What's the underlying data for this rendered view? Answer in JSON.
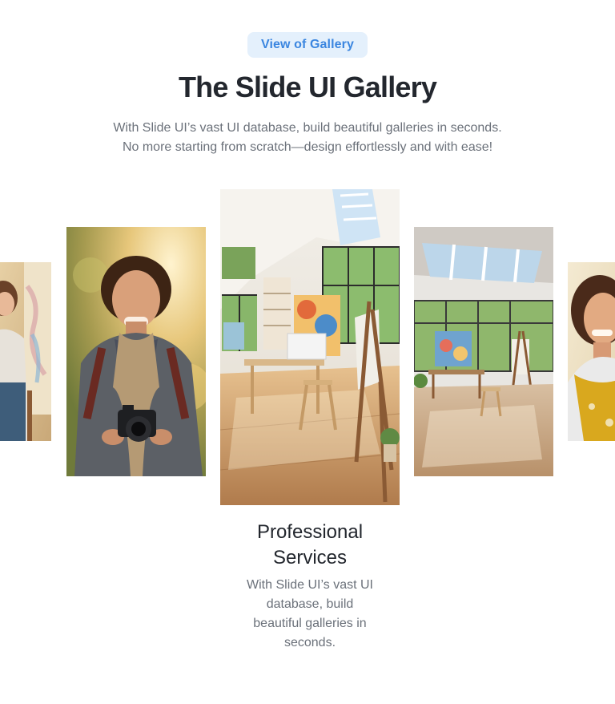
{
  "badge": {
    "label": "View of Gallery"
  },
  "header": {
    "title": "The Slide UI Gallery",
    "subtitle_lines": [
      "With Slide UI’s vast UI database, build beautiful galleries in seconds.",
      "No more starting from scratch—design effortlessly and with ease!"
    ]
  },
  "gallery": {
    "active_card": {
      "title_lines": [
        "Professional",
        "Services"
      ],
      "description_lines": [
        "With Slide UI’s vast UI",
        "database, build",
        "beautiful galleries in",
        "seconds."
      ]
    },
    "slides": [
      {
        "image": "painter-woman-photo"
      },
      {
        "image": "photographer-man-photo"
      },
      {
        "image": "art-studio-photo"
      },
      {
        "image": "art-studio-skylight-photo"
      },
      {
        "image": "smiling-artist-woman-photo"
      }
    ]
  }
}
